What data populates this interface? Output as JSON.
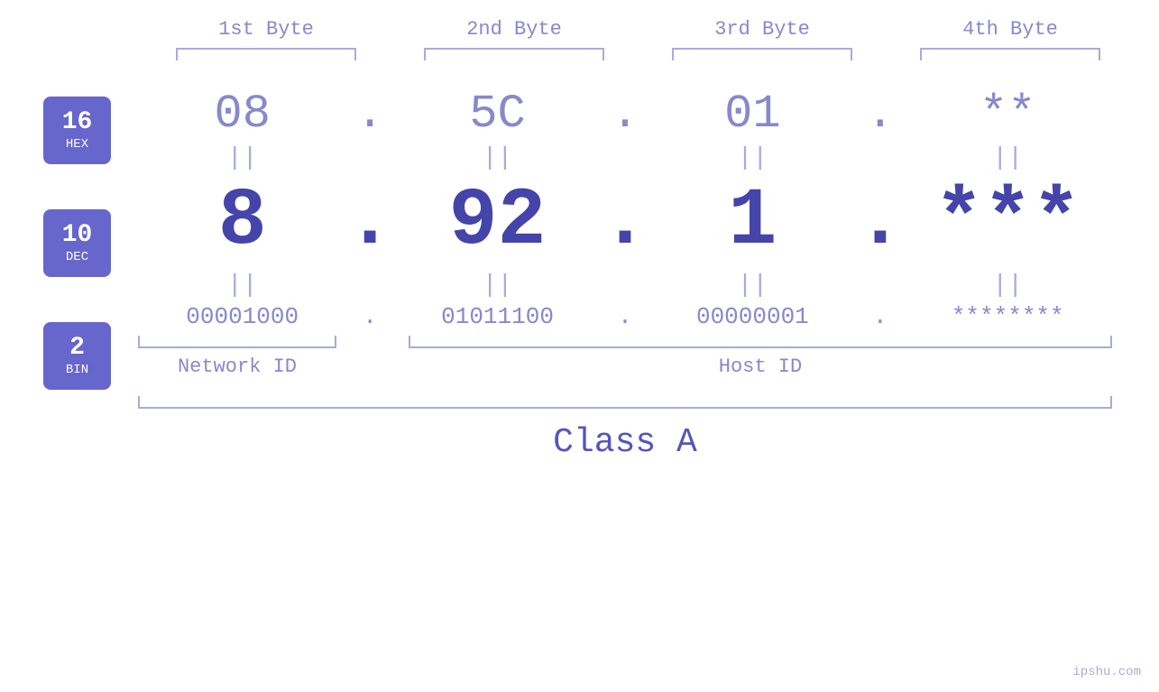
{
  "headers": {
    "byte1": "1st Byte",
    "byte2": "2nd Byte",
    "byte3": "3rd Byte",
    "byte4": "4th Byte"
  },
  "badges": {
    "hex": {
      "number": "16",
      "label": "HEX"
    },
    "dec": {
      "number": "10",
      "label": "DEC"
    },
    "bin": {
      "number": "2",
      "label": "BIN"
    }
  },
  "hex_row": {
    "b1": "08",
    "b2": "5C",
    "b3": "01",
    "b4": "**",
    "dot": "."
  },
  "dec_row": {
    "b1": "8",
    "b2": "92",
    "b3": "1",
    "b4": "***",
    "dot": "."
  },
  "bin_row": {
    "b1": "00001000",
    "b2": "01011100",
    "b3": "00000001",
    "b4": "********",
    "dot": "."
  },
  "equals": "||",
  "labels": {
    "network_id": "Network ID",
    "host_id": "Host ID",
    "class": "Class A"
  },
  "watermark": "ipshu.com"
}
